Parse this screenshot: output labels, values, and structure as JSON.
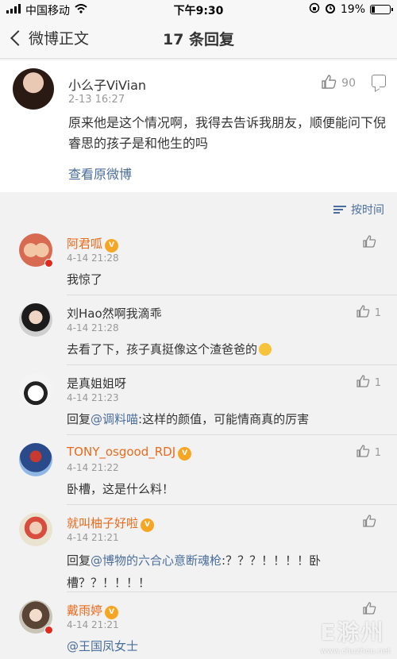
{
  "status_bar": {
    "carrier": "中国移动",
    "time": "下午9:30",
    "battery": "19%",
    "battery_level": 0.19
  },
  "nav": {
    "back_label": "微博正文",
    "title": "17 条回复"
  },
  "main_post": {
    "username": "小么子ViVian",
    "time": "2-13 16:27",
    "like_count": "90",
    "content": "原来他是这个情况啊，我得去告诉我朋友，顺便能问下倪睿思的孩子是和他生的吗",
    "view_original": "查看原微博"
  },
  "sort": {
    "label": "按时间"
  },
  "comments": [
    {
      "username": "阿君呱",
      "vip": true,
      "time": "4-14 21:28",
      "like_count": "",
      "body_prefix": "",
      "mention": "",
      "body": "我惊了"
    },
    {
      "username": "刘Hao然啊我滴乖",
      "vip": false,
      "time": "4-14 21:28",
      "like_count": "1",
      "body_prefix": "",
      "mention": "",
      "body": "去看了下，孩子真挺像这个渣爸爸的"
    },
    {
      "username": "是真姐姐呀",
      "vip": false,
      "time": "4-14 21:23",
      "like_count": "1",
      "body_prefix": "回复",
      "mention": "@调料喵",
      "body": ":这样的颜值，可能情商真的厉害"
    },
    {
      "username": "TONY_osgood_RDJ",
      "vip": true,
      "time": "4-14 21:22",
      "like_count": "1",
      "body_prefix": "",
      "mention": "",
      "body": "卧槽，这是什么料！"
    },
    {
      "username": "就叫柚子好啦",
      "vip": true,
      "time": "4-14 21:21",
      "like_count": "",
      "body_prefix": "回复",
      "mention": "@博物的六合心意断魂枪",
      "body": ":？？？！！！！卧槽？？！！！！"
    },
    {
      "username": "戴雨婷",
      "vip": true,
      "time": "4-14 21:21",
      "like_count": "",
      "body_prefix": "",
      "mention": "@王国凤女士",
      "body": ""
    }
  ],
  "watermark": {
    "text": "E滁州",
    "sub": "www.chuzhou.net"
  },
  "colors": {
    "link": "#4a6e9c",
    "vip_name": "#e86b1c",
    "background": "#f2f2f2"
  }
}
